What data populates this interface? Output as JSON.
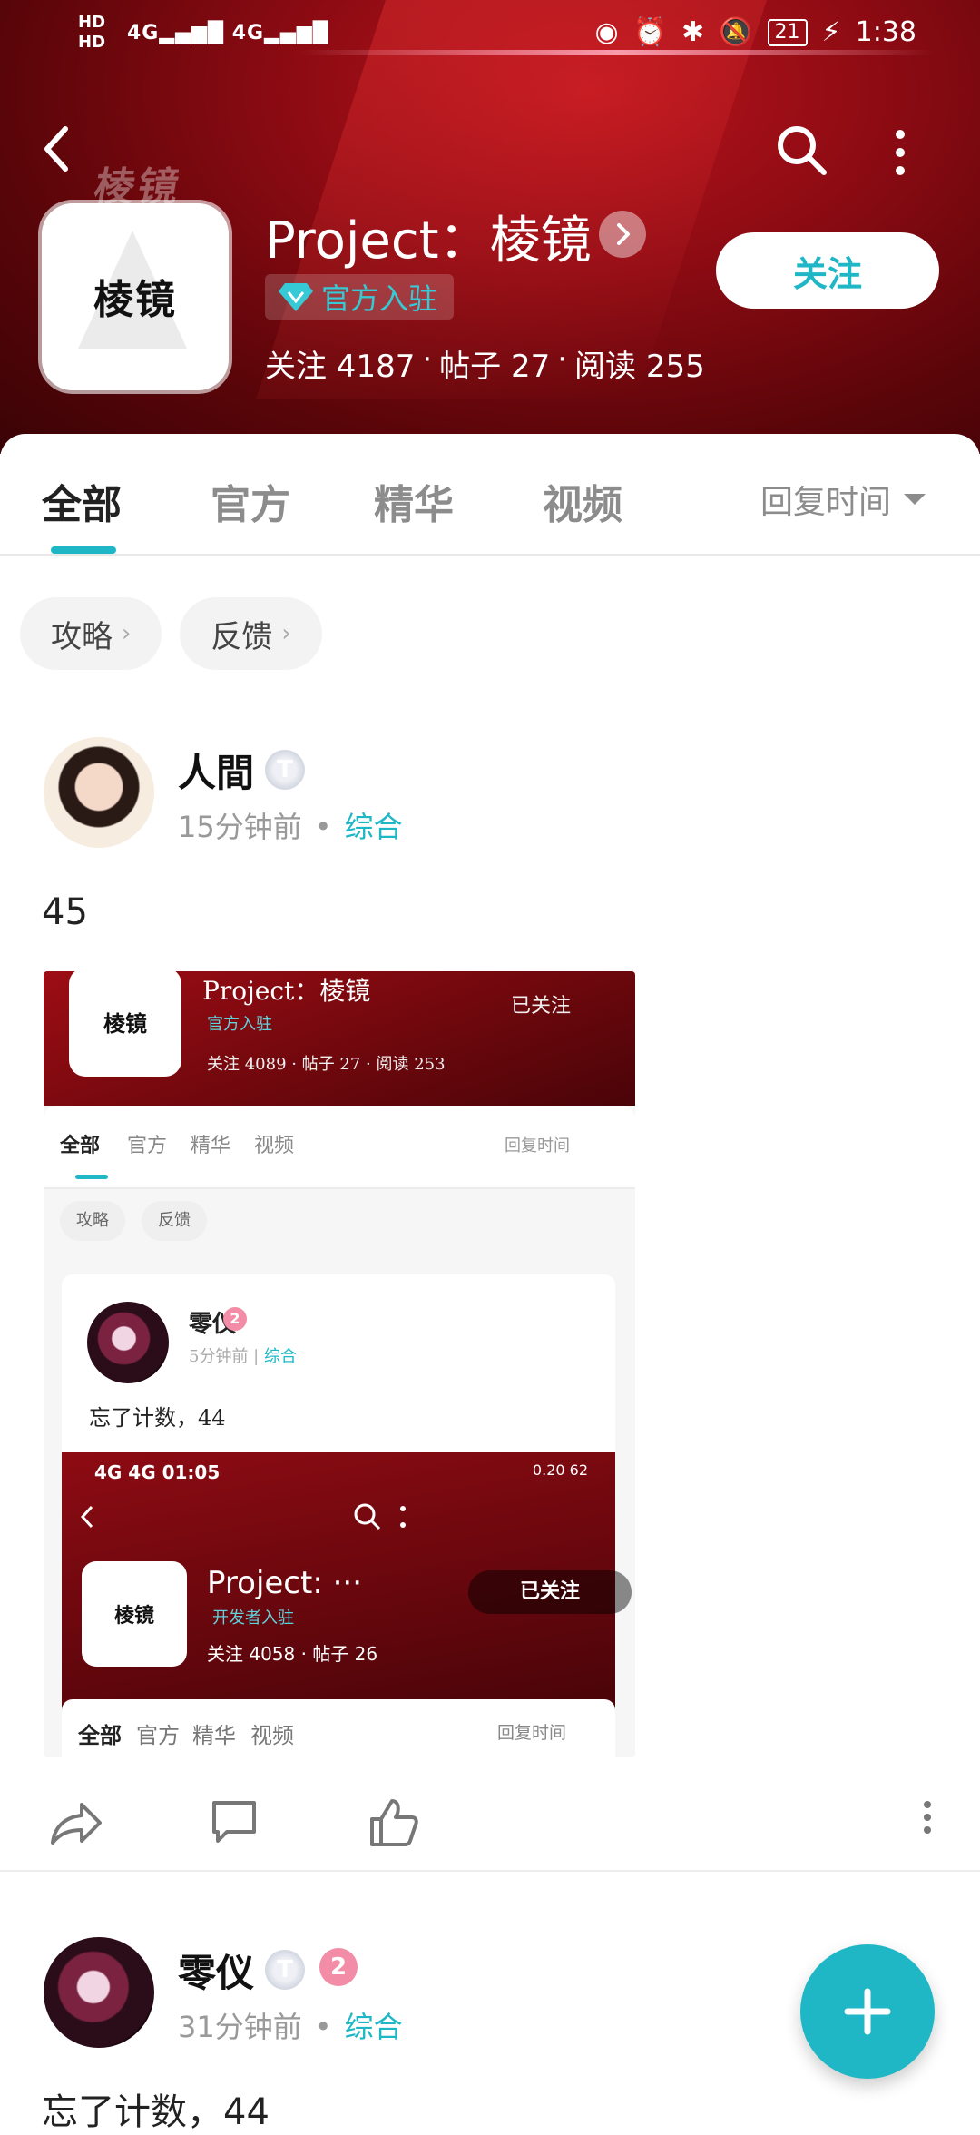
{
  "status_bar": {
    "hd1": "HD",
    "hd2": "HD",
    "network1": "4G",
    "network2": "4G",
    "battery": "21",
    "time": "1:38"
  },
  "forum": {
    "logo_text": "棱镜",
    "title": "Project：棱镜",
    "official_badge": "官方入驻",
    "stats": [
      "关注 4187",
      "帖子 27",
      "阅读 255"
    ],
    "follow_button": "关注"
  },
  "tabs": {
    "items": [
      "全部",
      "官方",
      "精华",
      "视频"
    ],
    "active": "全部",
    "sort_label": "回复时间"
  },
  "chips": [
    "攻略",
    "反馈"
  ],
  "posts": [
    {
      "username": "人間",
      "badge_t": "T",
      "time": "15分钟前",
      "category": "综合",
      "text": "45",
      "screenshot": {
        "title": "Project：棱镜",
        "followed": "已关注",
        "official": "官方入驻",
        "stats": "关注 4089 · 帖子 27 · 阅读 253",
        "tabs": [
          "全部",
          "官方",
          "精华",
          "视频"
        ],
        "sort": "回复时间",
        "chips": [
          "攻略",
          "反馈"
        ],
        "card": {
          "username": "零仪",
          "level": "2",
          "meta_time": "5分钟前",
          "meta_cat": "综合",
          "text": "忘了计数，44",
          "inner": {
            "status_left": "4G 4G 01:05",
            "status_right": "0.20 62",
            "title": "Project: ···",
            "dev_badge": "开发者入驻",
            "stats": "关注 4058 · 帖子 26",
            "followed": "已关注",
            "tabs": [
              "全部",
              "官方",
              "精华",
              "视频"
            ],
            "sort": "回复时间"
          }
        }
      }
    },
    {
      "username": "零仪",
      "badge_t": "T",
      "level": "2",
      "time": "31分钟前",
      "category": "综合",
      "text": "忘了计数，44"
    }
  ],
  "colors": {
    "accent": "#1fb7c6",
    "header_red": "#8e0b13",
    "level_pink": "#f38ca6"
  },
  "icons": [
    "back-icon",
    "search-icon",
    "more-vertical-icon",
    "chevron-right-icon",
    "diamond-icon",
    "share-icon",
    "comment-icon",
    "like-icon",
    "more-horizontal-icon",
    "plus-icon"
  ]
}
